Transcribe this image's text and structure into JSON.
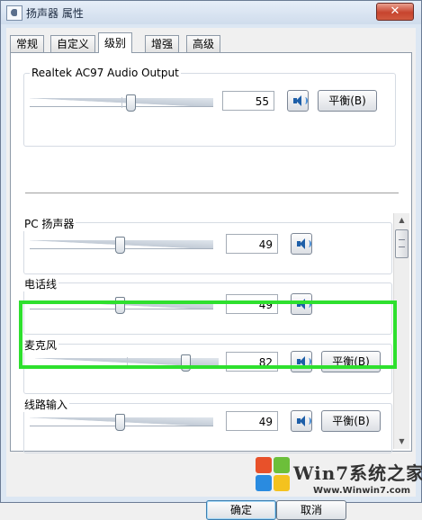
{
  "window": {
    "title": "扬声器 属性",
    "close_glyph": "✕"
  },
  "tabs": [
    {
      "label": "常规",
      "active": false
    },
    {
      "label": "自定义",
      "active": false
    },
    {
      "label": "级别",
      "active": true
    },
    {
      "label": "增强",
      "active": false
    },
    {
      "label": "高级",
      "active": false
    }
  ],
  "devices": [
    {
      "name": "Realtek AC97 Audio Output",
      "value": 55,
      "level": 0.55,
      "balance_label": "平衡(B)",
      "icon": "speaker-icon"
    },
    {
      "name": "PC 扬声器",
      "value": 49,
      "level": 0.49,
      "balance_label": "",
      "icon": "speaker-icon"
    },
    {
      "name": "电话线",
      "value": 49,
      "level": 0.49,
      "balance_label": "",
      "icon": "speaker-icon"
    },
    {
      "name": "麦克风",
      "value": 82,
      "level": 0.82,
      "balance_label": "平衡(B)",
      "icon": "speaker-icon",
      "highlighted": true
    },
    {
      "name": "线路输入",
      "value": 49,
      "level": 0.49,
      "balance_label": "平衡(B)",
      "icon": "speaker-icon"
    }
  ],
  "footer": {
    "ok_label": "确定",
    "cancel_label": "取消"
  },
  "watermark": {
    "brand": "Win7系统之家",
    "url": "Www.Winwin7.com"
  },
  "colors": {
    "highlight": "#2ee02e",
    "close": "#c7442e",
    "accent": "#1e5fa8"
  }
}
